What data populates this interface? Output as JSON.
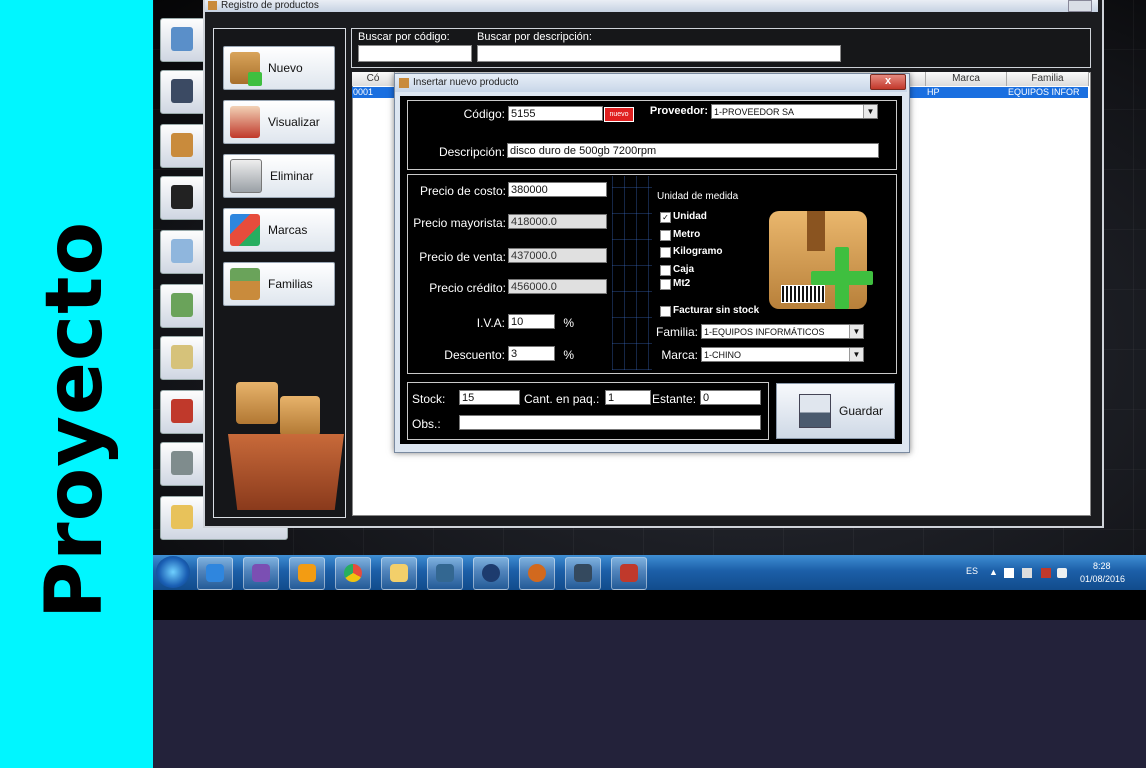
{
  "banner": {
    "text": "Proyecto"
  },
  "main_window": {
    "title": "Registro de productos"
  },
  "sidebar": {
    "buttons": [
      {
        "label": "Nuevo",
        "icon": "box-plus-icon"
      },
      {
        "label": "Visualizar",
        "icon": "person-icon"
      },
      {
        "label": "Eliminar",
        "icon": "trash-icon"
      },
      {
        "label": "Marcas",
        "icon": "tags-icon"
      },
      {
        "label": "Familias",
        "icon": "box-bottles-icon"
      }
    ]
  },
  "search": {
    "by_code_label": "Buscar por código:",
    "by_description_label": "Buscar por descripción:"
  },
  "grid": {
    "columns": [
      "Có",
      "Marca",
      "Familia"
    ],
    "row": {
      "code": "0001",
      "marca": "HP",
      "familia": "EQUIPOS INFOR"
    }
  },
  "dialog": {
    "title": "Insertar nuevo producto",
    "close_label": "x",
    "codigo_label": "Código:",
    "codigo_value": "5155",
    "nuevo_badge": "nuevo",
    "proveedor_label": "Proveedor:",
    "proveedor_value": "1-PROVEEDOR SA",
    "descripcion_label": "Descripción:",
    "descripcion_value": "disco duro de 500gb 7200rpm",
    "costo_label": "Precio de costo:",
    "costo_value": "380000",
    "mayorista_label": "Precio mayorista:",
    "mayorista_value": "418000.0",
    "venta_label": "Precio de venta:",
    "venta_value": "437000.0",
    "credito_label": "Precio crédito:",
    "credito_value": "456000.0",
    "iva_label": "I.V.A:",
    "iva_value": "10",
    "iva_unit": "%",
    "descuento_label": "Descuento:",
    "descuento_value": "3",
    "descuento_unit": "%",
    "unidad_title": "Unidad de medida",
    "unidades": [
      {
        "label": "Unidad",
        "checked": true
      },
      {
        "label": "Metro",
        "checked": false
      },
      {
        "label": "Kilogramo",
        "checked": false
      },
      {
        "label": "Caja",
        "checked": false
      },
      {
        "label": "Mt2",
        "checked": false
      }
    ],
    "check_mark": "✓",
    "facturar_label": "Facturar sin stock",
    "familia_label": "Familia:",
    "familia_value": "1-EQUIPOS INFORMÁTICOS",
    "marca_label": "Marca:",
    "marca_value": "1-CHINO",
    "stock_label": "Stock:",
    "stock_value": "15",
    "paq_label": "Cant. en paq.:",
    "paq_value": "1",
    "estante_label": "Estante:",
    "estante_value": "0",
    "obs_label": "Obs.:",
    "obs_value": "",
    "guardar_label": "Guardar"
  },
  "taskbar": {
    "language": "ES",
    "time": "8:28",
    "date": "01/08/2016",
    "apps": [
      "windows-start-icon",
      "ie-icon",
      "visual-studio-icon",
      "media-player-icon",
      "chrome-icon",
      "folder-icon",
      "postgresql-icon",
      "netbeans-icon",
      "baseball-glove-icon",
      "app-icon",
      "jasper-icon"
    ]
  },
  "colors": {
    "accent_blue": "#1a6fe0",
    "banner_cyan": "#00f6ff",
    "close_red": "#c2382a"
  }
}
